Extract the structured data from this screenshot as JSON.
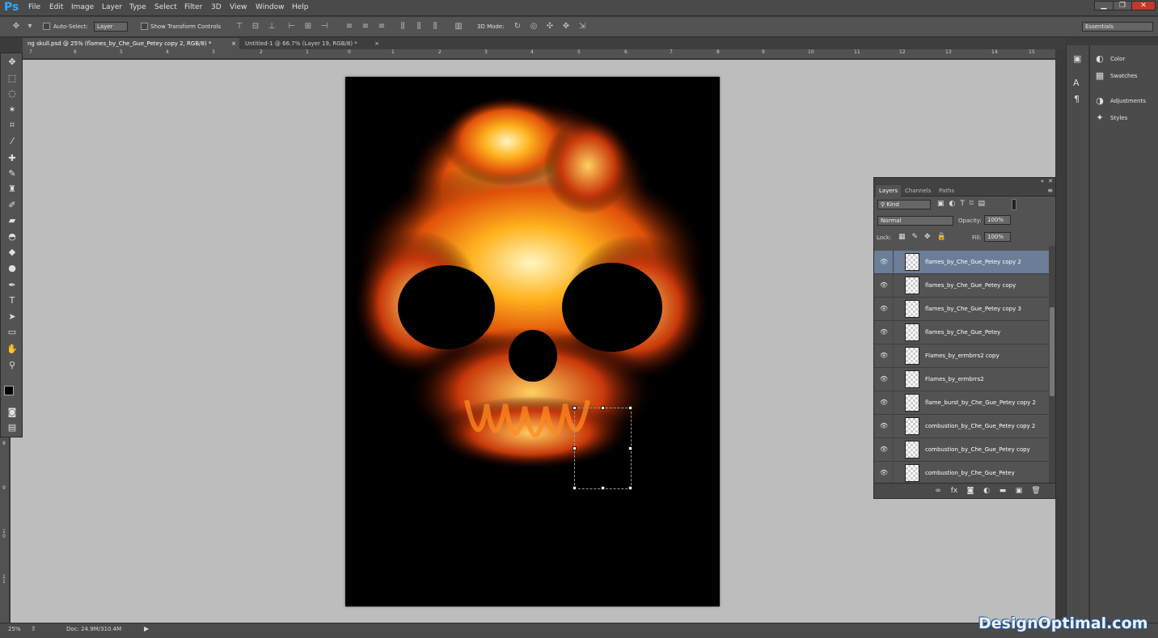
{
  "app": {
    "logo": "Ps"
  },
  "menu": [
    "File",
    "Edit",
    "Image",
    "Layer",
    "Type",
    "Select",
    "Filter",
    "3D",
    "View",
    "Window",
    "Help"
  ],
  "window_controls": [
    "▁",
    "❐",
    "✕"
  ],
  "options": {
    "auto_select_label": "Auto-Select:",
    "auto_select_value": "Layer",
    "show_transform_label": "Show Transform Controls",
    "mode_label": "3D Mode:",
    "workspace": "Essentials"
  },
  "tabs": [
    {
      "label": "ng skull.psd @ 25% (flames_by_Che_Gue_Petey copy 2, RGB/8) *",
      "close": "×"
    },
    {
      "label": "Untitled-1 @ 66.7% (Layer 19, RGB/8) *",
      "close": "×"
    }
  ],
  "ruler_top": [
    "7",
    "6",
    "5",
    "4",
    "3",
    "2",
    "1",
    "0",
    "1",
    "2",
    "3",
    "4",
    "5",
    "6",
    "7",
    "8",
    "9",
    "10",
    "11",
    "12",
    "13",
    "14",
    "15"
  ],
  "ruler_left": [
    "8",
    "9",
    "1\n0",
    "1\n1"
  ],
  "panels": {
    "color": "Color",
    "swatches": "Swatches",
    "adjustments": "Adjustments",
    "styles": "Styles"
  },
  "layers_panel": {
    "tabs": [
      "Layers",
      "Channels",
      "Paths"
    ],
    "kind": "Kind",
    "blend_mode": "Normal",
    "opacity_label": "Opacity:",
    "opacity_value": "100%",
    "lock_label": "Lock:",
    "fill_label": "Fill:",
    "fill_value": "100%",
    "layers": [
      {
        "name": "flames_by_Che_Gue_Petey copy 2",
        "selected": true
      },
      {
        "name": "flames_by_Che_Gue_Petey copy",
        "selected": false
      },
      {
        "name": "flames_by_Che_Gue_Petey copy 3",
        "selected": false
      },
      {
        "name": "flames_by_Che_Gue_Petey",
        "selected": false
      },
      {
        "name": "Flames_by_ermbrrs2 copy",
        "selected": false
      },
      {
        "name": "Flames_by_ermbrrs2",
        "selected": false
      },
      {
        "name": "flame_burst_by_Che_Gue_Petey copy 2",
        "selected": false
      },
      {
        "name": "combustion_by_Che_Gue_Petey copy 2",
        "selected": false
      },
      {
        "name": "combustion_by_Che_Gue_Petey copy",
        "selected": false
      },
      {
        "name": "combustion_by_Che_Gue_Petey",
        "selected": false
      }
    ]
  },
  "status": {
    "zoom": "25%",
    "doc": "Doc: 24.9M/310.4M"
  },
  "watermark": "DesignOptimal.com"
}
